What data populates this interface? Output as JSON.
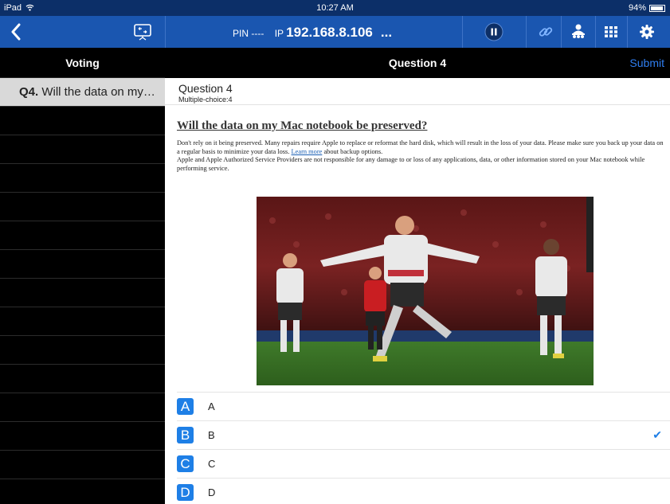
{
  "status_bar": {
    "device": "iPad",
    "time": "10:27 AM",
    "battery": "94%"
  },
  "nav_bar": {
    "pin_label": "PIN",
    "pin_value": "----",
    "ip_label": "IP",
    "ip_value": "192.168.8.106",
    "ellipsis": "..."
  },
  "sidebar": {
    "title": "Voting",
    "items": [
      {
        "number": "Q4.",
        "text": "Will the data on my…"
      }
    ]
  },
  "main": {
    "header_title": "Question 4",
    "submit_label": "Submit",
    "question_title": "Question 4",
    "question_type": "Multiple-choice:4",
    "heading": "Will the data on my Mac notebook be preserved?",
    "body_part1": "Don't rely on it being preserved. Many repairs require Apple to replace or reformat the hard disk, which will result in the loss of your data. Please make sure you back up your data on a regular basis to minimize your data loss. ",
    "body_link": "Learn more",
    "body_part2": " about backup options.",
    "body_para2": "Apple and Apple Authorized Service Providers are not responsible for any damage to or loss of any applications, data, or other information stored on your Mac notebook while performing service.",
    "options": [
      {
        "letter": "A",
        "label": "A",
        "selected": false
      },
      {
        "letter": "B",
        "label": "B",
        "selected": true
      },
      {
        "letter": "C",
        "label": "C",
        "selected": false
      },
      {
        "letter": "D",
        "label": "D",
        "selected": false
      }
    ]
  },
  "colors": {
    "nav_blue": "#1a56b0",
    "status_navy": "#0c2f68",
    "accent": "#1e7fe6"
  }
}
